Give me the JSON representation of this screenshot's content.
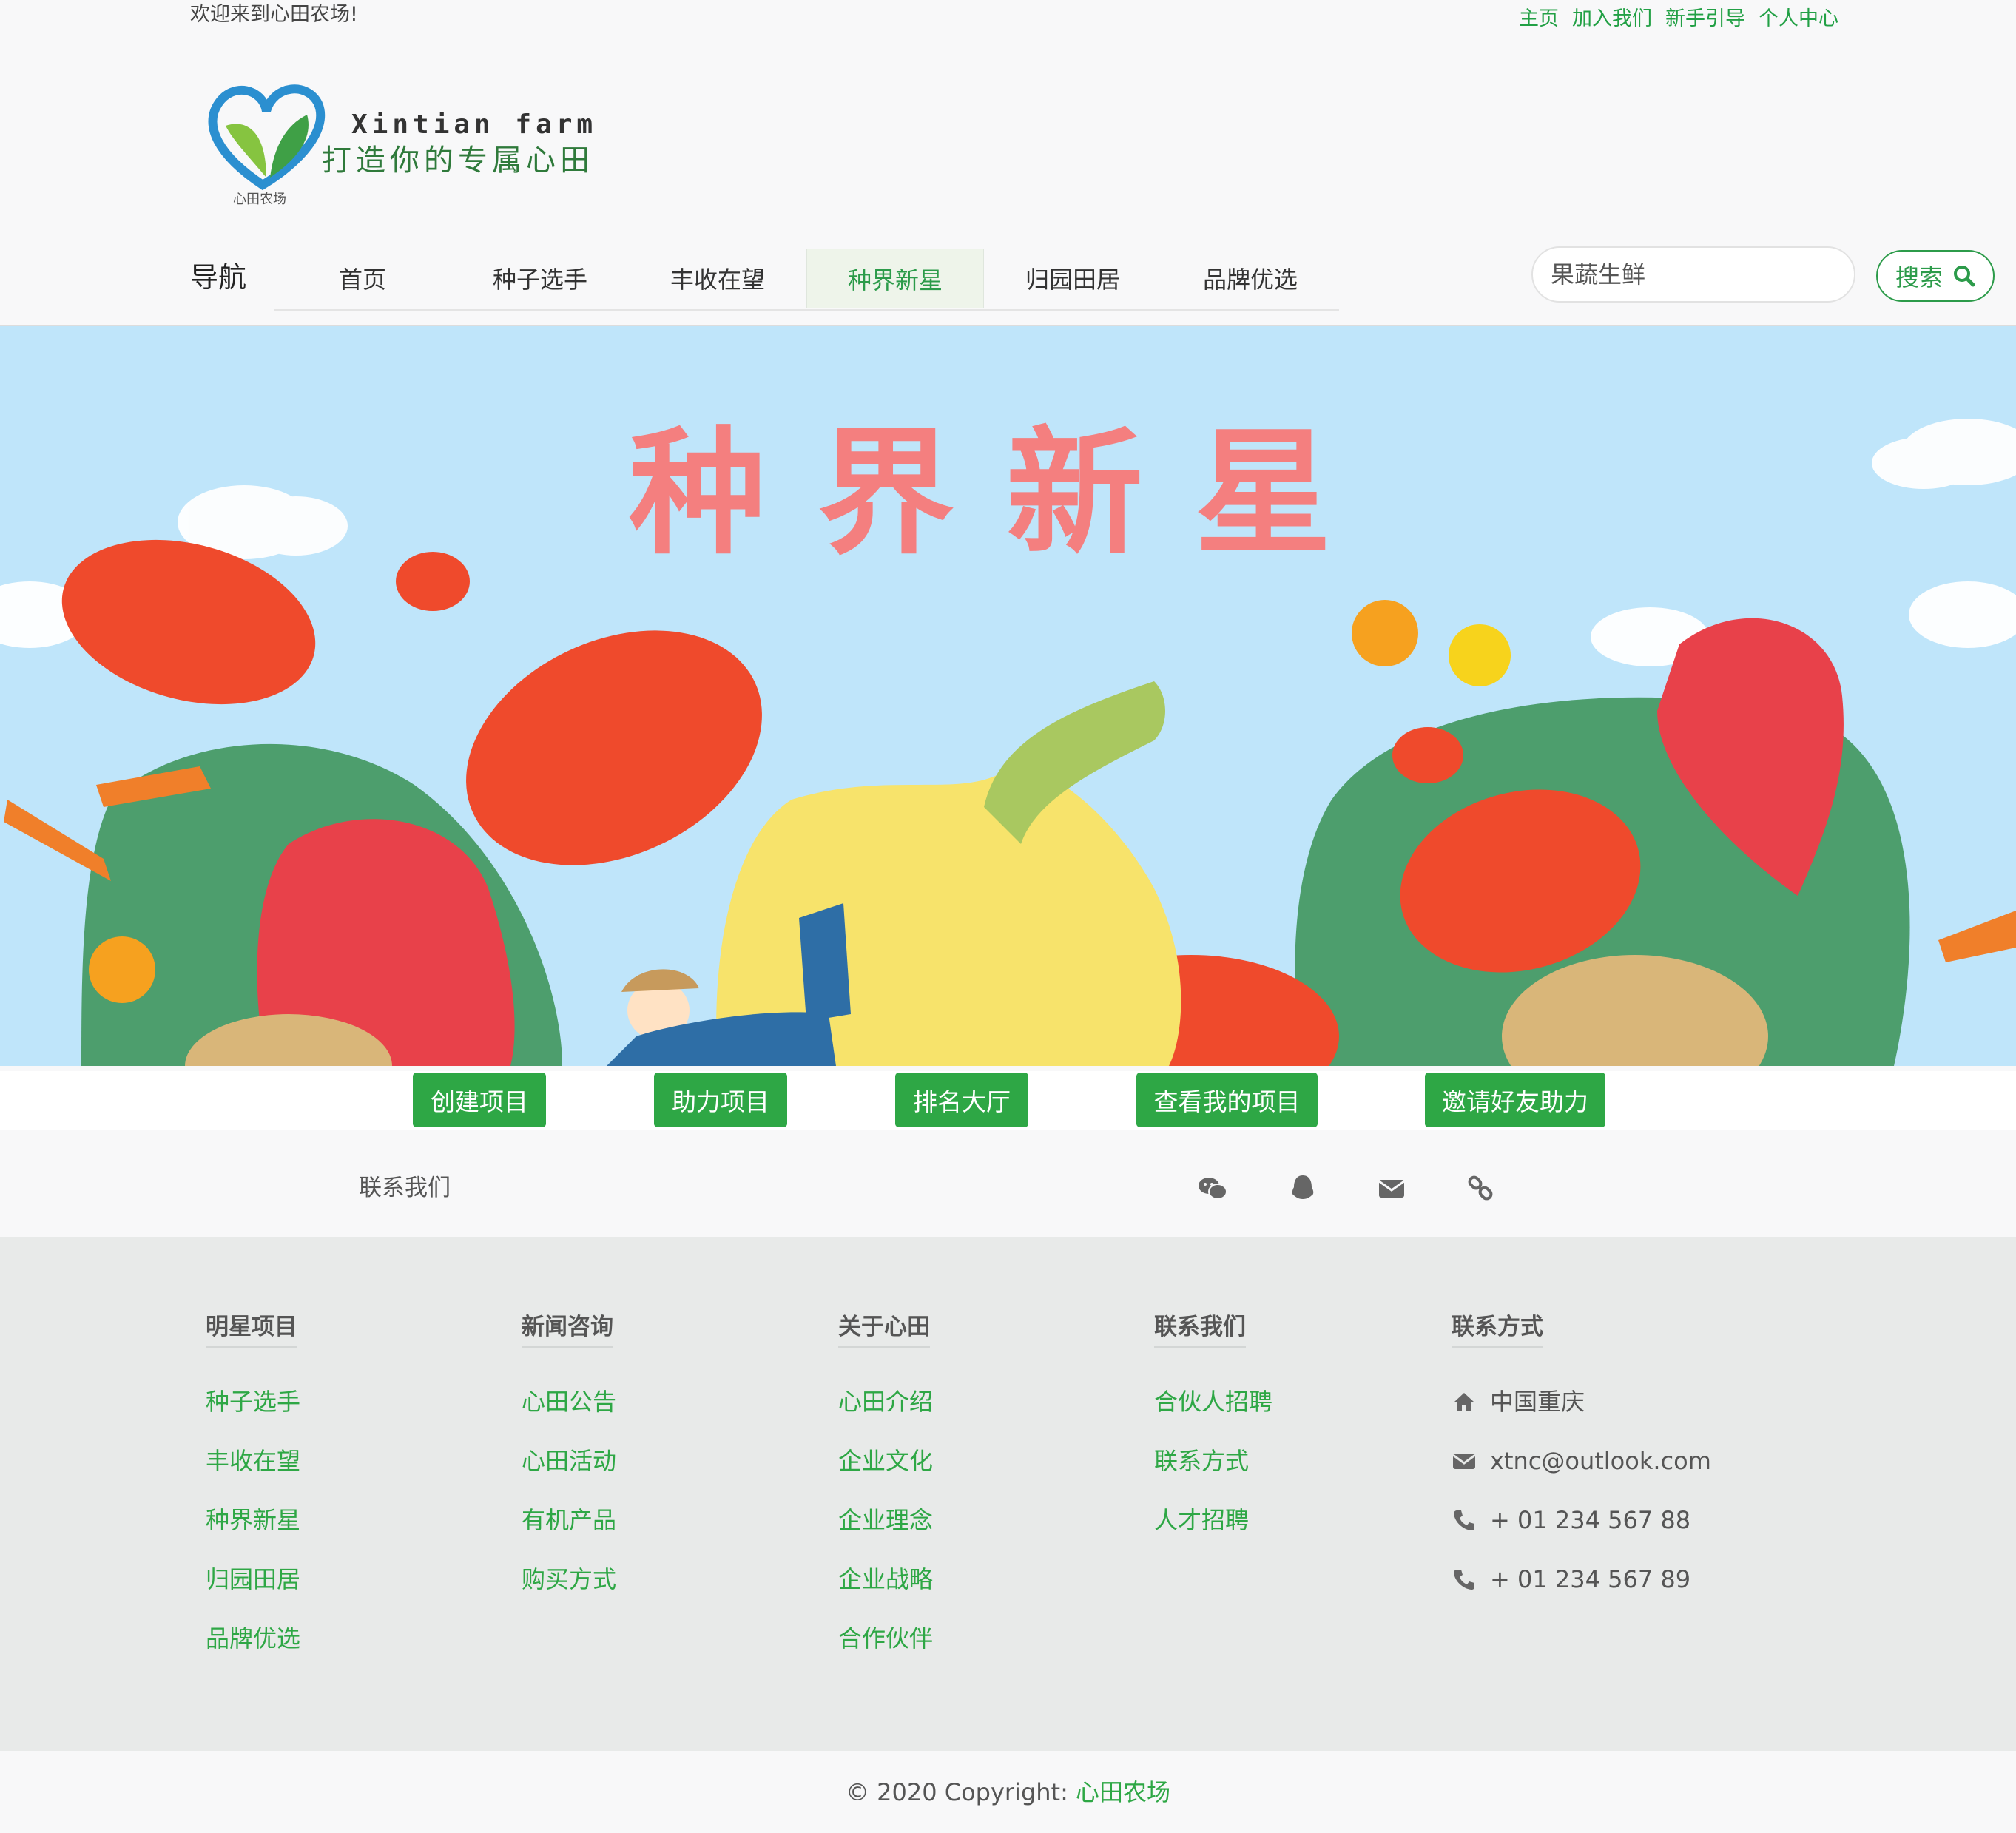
{
  "header": {
    "welcome": "欢迎来到心田农场!",
    "top_links": [
      "主页",
      "加入我们",
      "新手引导",
      "个人中心"
    ]
  },
  "logo": {
    "en_name": "Xintian farm",
    "slogan": "打造你的专属心田",
    "cn_name": "心田农场"
  },
  "nav": {
    "title": "导航",
    "items": [
      "首页",
      "种子选手",
      "丰收在望",
      "种界新星",
      "归园田居",
      "品牌优选"
    ],
    "active": "种界新星"
  },
  "search": {
    "placeholder": "果蔬生鲜",
    "button_label": "搜索"
  },
  "banner": {
    "title": "种界新星"
  },
  "actions": [
    "创建项目",
    "助力项目",
    "排名大厅",
    "查看我的项目",
    "邀请好友助力"
  ],
  "contact_bar": {
    "label": "联系我们",
    "icons": [
      "wechat-icon",
      "qq-icon",
      "envelope-icon",
      "link-icon"
    ]
  },
  "footer": {
    "columns": [
      {
        "title": "明星项目",
        "links": [
          "种子选手",
          "丰收在望",
          "种界新星",
          "归园田居",
          "品牌优选"
        ]
      },
      {
        "title": "新闻咨询",
        "links": [
          "心田公告",
          "心田活动",
          "有机产品",
          "购买方式"
        ]
      },
      {
        "title": "关于心田",
        "links": [
          "心田介绍",
          "企业文化",
          "企业理念",
          "企业战略",
          "合作伙伴"
        ]
      },
      {
        "title": "联系我们",
        "links": [
          "合伙人招聘",
          "联系方式",
          "人才招聘"
        ]
      }
    ],
    "contact": {
      "title": "联系方式",
      "address": "中国重庆",
      "email": "xtnc@outlook.com",
      "phone1": "+ 01 234 567 88",
      "phone2": "+ 01 234 567 89"
    }
  },
  "copyright": {
    "prefix": "© 2020 Copyright: ",
    "brand": "心田农场"
  },
  "colors": {
    "accent": "#2ea745",
    "banner_sky": "#bfe5fa",
    "banner_title": "#f47f7f",
    "footer_bg": "#e8eae9"
  }
}
